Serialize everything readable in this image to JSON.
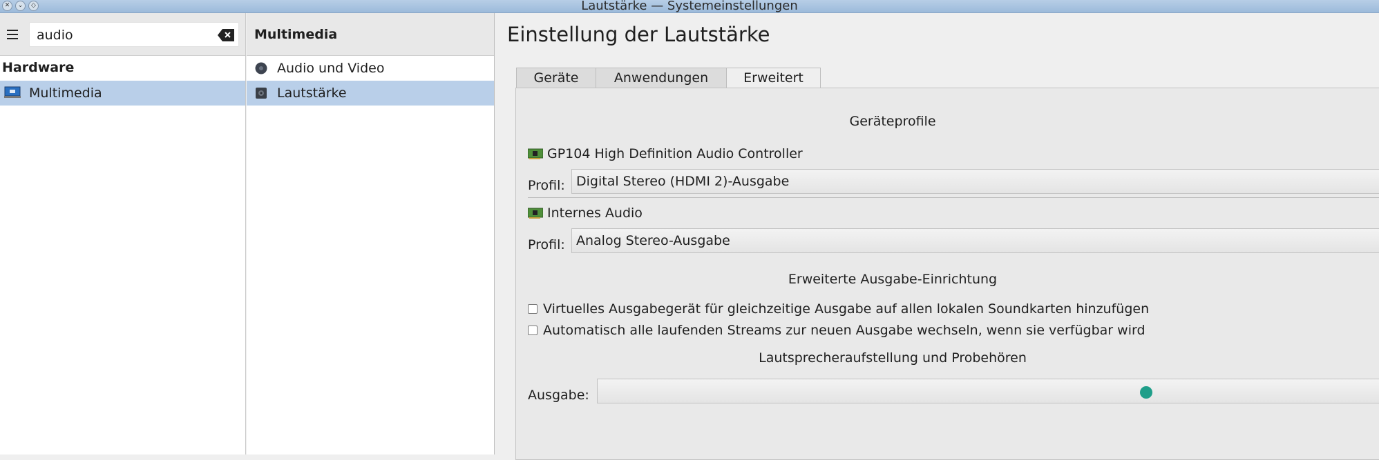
{
  "window": {
    "title": "Lautstärke — Systemeinstellungen"
  },
  "search": {
    "value": "audio"
  },
  "sidebar": {
    "category": "Hardware",
    "items": [
      {
        "label": "Multimedia",
        "selected": true
      }
    ]
  },
  "subcategory": {
    "header": "Multimedia",
    "items": [
      {
        "label": "Audio und Video",
        "selected": false
      },
      {
        "label": "Lautstärke",
        "selected": true
      }
    ]
  },
  "main": {
    "title": "Einstellung der Lautstärke",
    "tabs": [
      {
        "label": "Geräte"
      },
      {
        "label": "Anwendungen"
      },
      {
        "label": "Erweitert",
        "active": true
      }
    ],
    "profiles_header": "Geräteprofile",
    "devices": [
      {
        "name": "GP104 High Definition Audio Controller",
        "profile_label": "Profil:",
        "profile": "Digital Stereo (HDMI 2)-Ausgabe"
      },
      {
        "name": "Internes Audio",
        "profile_label": "Profil:",
        "profile": "Analog Stereo-Ausgabe"
      }
    ],
    "advanced_header": "Erweiterte Ausgabe-Einrichtung",
    "checkboxes": [
      {
        "label": "Virtuelles Ausgabegerät für gleichzeitige Ausgabe auf allen lokalen Soundkarten hinzufügen",
        "checked": false
      },
      {
        "label": "Automatisch alle laufenden Streams zur neuen Ausgabe wechseln, wenn sie verfügbar wird",
        "checked": false
      }
    ],
    "speaker_header": "Lautsprecheraufstellung und Probehören",
    "output_label": "Ausgabe:",
    "output_value": ""
  },
  "colors": {
    "selection": "#b9cfe9",
    "accent": "#1f9e89",
    "titlebar": "#a9c4e0"
  }
}
